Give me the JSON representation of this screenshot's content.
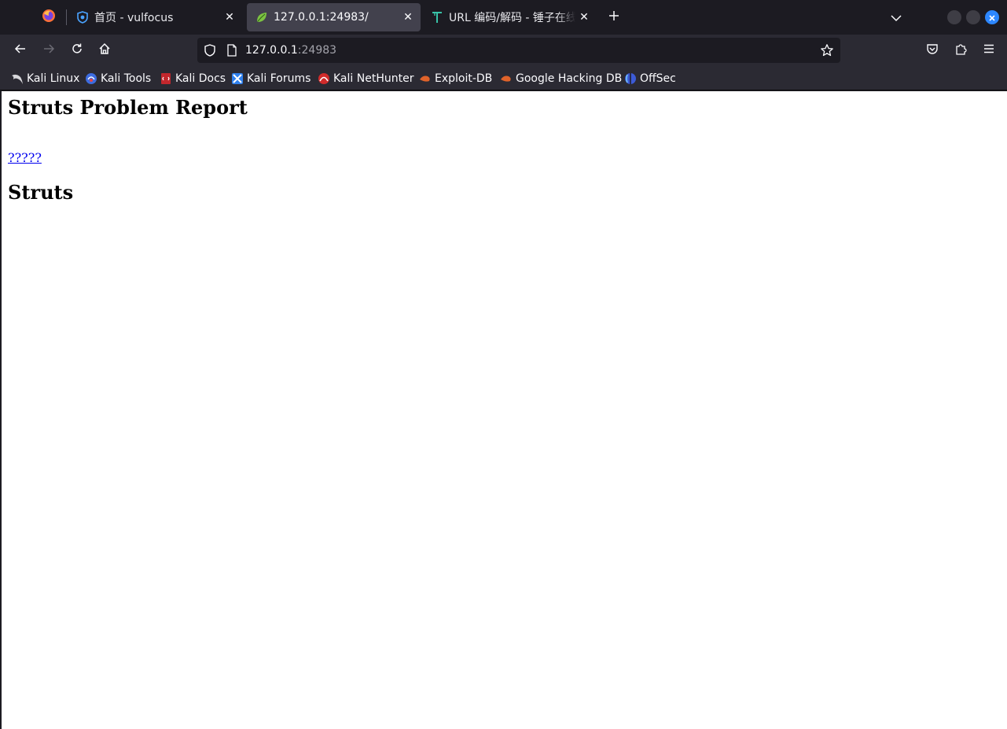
{
  "browser": {
    "tabs": [
      {
        "title": "首页 - vulfocus",
        "favicon": "vulfocus-shield-icon",
        "active": false
      },
      {
        "title": "127.0.0.1:24983/",
        "favicon": "spring-leaf-icon",
        "active": true
      },
      {
        "title": "URL 编码/解码 - 锤子在线",
        "favicon": "hammer-t-icon",
        "active": false
      }
    ],
    "close_glyph": "✕",
    "new_tab_glyph": "+",
    "url": {
      "host": "127.0.0.1",
      "port": ":24983"
    }
  },
  "bookmarks": [
    {
      "label": "Kali Linux",
      "icon": "kali-dragon-icon"
    },
    {
      "label": "Kali Tools",
      "icon": "kali-tools-icon"
    },
    {
      "label": "Kali Docs",
      "icon": "kali-docs-icon"
    },
    {
      "label": "Kali Forums",
      "icon": "kali-forums-icon"
    },
    {
      "label": "Kali NetHunter",
      "icon": "kali-nethunter-icon"
    },
    {
      "label": "Exploit-DB",
      "icon": "exploit-db-icon"
    },
    {
      "label": "Google Hacking DB",
      "icon": "ghdb-icon"
    },
    {
      "label": "OffSec",
      "icon": "offsec-icon"
    }
  ],
  "page": {
    "heading": "Struts Problem Report",
    "link_text": "?????",
    "subheading": "Struts"
  },
  "colors": {
    "accent": "#2d87ff",
    "link": "#0000ee",
    "toolbar": "#2b2a33",
    "tabstrip": "#1c1b22"
  }
}
